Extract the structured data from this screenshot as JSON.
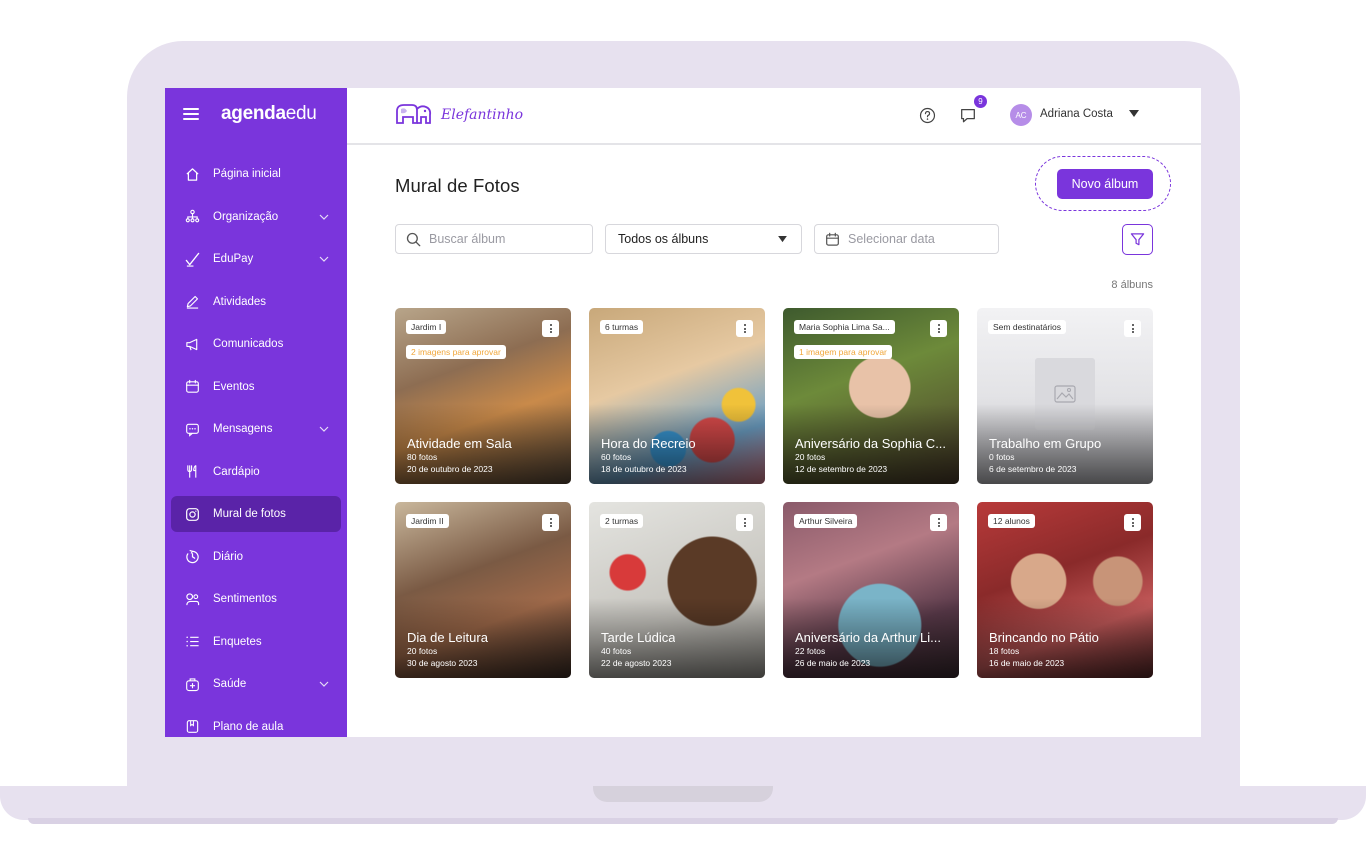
{
  "sidebar": {
    "brand_bold": "agenda",
    "brand_light": "edu",
    "items": [
      {
        "label": "Página inicial",
        "icon": "home-icon",
        "chevron": false
      },
      {
        "label": "Organização",
        "icon": "org-chart-icon",
        "chevron": true
      },
      {
        "label": "EduPay",
        "icon": "pen-check-icon",
        "chevron": true
      },
      {
        "label": "Atividades",
        "icon": "pencil-icon",
        "chevron": false
      },
      {
        "label": "Comunicados",
        "icon": "megaphone-icon",
        "chevron": false
      },
      {
        "label": "Eventos",
        "icon": "calendar-icon",
        "chevron": false
      },
      {
        "label": "Mensagens",
        "icon": "chat-icon",
        "chevron": true
      },
      {
        "label": "Cardápio",
        "icon": "utensils-icon",
        "chevron": false
      },
      {
        "label": "Mural de fotos",
        "icon": "camera-icon",
        "chevron": false,
        "active": true
      },
      {
        "label": "Diário",
        "icon": "clock-icon",
        "chevron": false
      },
      {
        "label": "Sentimentos",
        "icon": "emotion-icon",
        "chevron": false
      },
      {
        "label": "Enquetes",
        "icon": "list-icon",
        "chevron": false
      },
      {
        "label": "Saúde",
        "icon": "medical-kit-icon",
        "chevron": true
      },
      {
        "label": "Plano de aula",
        "icon": "bookmark-icon",
        "chevron": false
      }
    ]
  },
  "header": {
    "school_name": "Elefantinho",
    "notifications": "9",
    "user_initials": "AC",
    "user_name": "Adriana Costa"
  },
  "page": {
    "title": "Mural de Fotos",
    "new_album_label": "Novo álbum",
    "search_placeholder": "Buscar álbum",
    "album_filter": "Todos os álbuns",
    "date_placeholder": "Selecionar data",
    "album_count": "8 álbuns"
  },
  "albums": [
    {
      "tag": "Jardim I",
      "pending": "2 imagens para aprovar",
      "title": "Atividade em Sala",
      "photos": "80 fotos",
      "date": "20 de outubro de 2023",
      "bg": "linear-gradient(160deg,#b8a58a 0%,#8d6d52 35%,#c98a4a 60%,#5a4a3a 100%)"
    },
    {
      "tag": "6 turmas",
      "pending": "",
      "title": "Hora do Recreio",
      "photos": "60 fotos",
      "date": "18 de outubro de 2023",
      "bg": "radial-gradient(circle at 70% 75%,#d84a4a 0 12%,transparent 13%),radial-gradient(circle at 45% 80%,#3a9ad8 0 10%,transparent 11%),radial-gradient(circle at 85% 55%,#f0c23a 0 9%,transparent 10%),linear-gradient(160deg,#c8a87a 0%,#e6c9a2 40%,#6c9fc4 75%,#d47a8a 100%)"
    },
    {
      "tag": "Maria Sophia Lima Sa...",
      "pending": "1 imagem para aprovar",
      "title": "Aniversário da Sophia C...",
      "photos": "20 fotos",
      "date": "12 de setembro de 2023",
      "bg": "radial-gradient(circle at 55% 45%,#e8c2a8 0 22%,transparent 23%),linear-gradient(160deg,#3e5a2e 0%,#6d8a3a 40%,#4a3a2a 100%)"
    },
    {
      "tag": "Sem destinatários",
      "pending": "",
      "title": "Trabalho em Grupo",
      "photos": "0 fotos",
      "date": "6 de setembro de 2023",
      "bg": "linear-gradient(180deg,#f2f2f4 0%,#e3e3e6 50%,#bdbdc2 100%)",
      "placeholder": true
    },
    {
      "tag": "Jardim II",
      "pending": "",
      "title": "Dia de Leitura",
      "photos": "20 fotos",
      "date": "30 de agosto 2023",
      "bg": "linear-gradient(160deg,#c9b79c 0%,#7a5a44 40%,#a06a4a 65%,#3e2e26 100%)"
    },
    {
      "tag": "2 turmas",
      "pending": "",
      "title": "Tarde Lúdica",
      "photos": "40 fotos",
      "date": "22 de agosto 2023",
      "bg": "radial-gradient(circle at 70% 45%,#5a3a26 0 28%,transparent 29%),radial-gradient(circle at 22% 40%,#d83a3a 0 10%,transparent 11%),linear-gradient(160deg,#e4e4e0 0%,#c7c5bf 60%,#9a9892 100%)"
    },
    {
      "tag": "Arthur Silveira",
      "pending": "",
      "title": "Aniversário da Arthur Li...",
      "photos": "22 fotos",
      "date": "26 de maio de 2023",
      "bg": "radial-gradient(circle at 55% 70%,#7ab4c8 0 26%,transparent 27%),linear-gradient(160deg,#8a5a6a 0%,#b47a84 35%,#5a3a4a 70%,#3a2a30 100%)"
    },
    {
      "tag": "12 alunos",
      "pending": "",
      "title": "Brincando no Pátio",
      "photos": "18 fotos",
      "date": "16 de maio de 2023",
      "bg": "radial-gradient(circle at 35% 45%,#d8a88a 0 18%,transparent 19%),radial-gradient(circle at 80% 45%,#c89478 0 14%,transparent 15%),linear-gradient(160deg,#b83a3a 0%,#8a2a2a 40%,#c45a5a 70%,#5a2a2a 100%)"
    }
  ],
  "colors": {
    "accent": "#7a35dc",
    "accent_dark": "#5a23a8",
    "pending_text": "#f0a63a"
  }
}
